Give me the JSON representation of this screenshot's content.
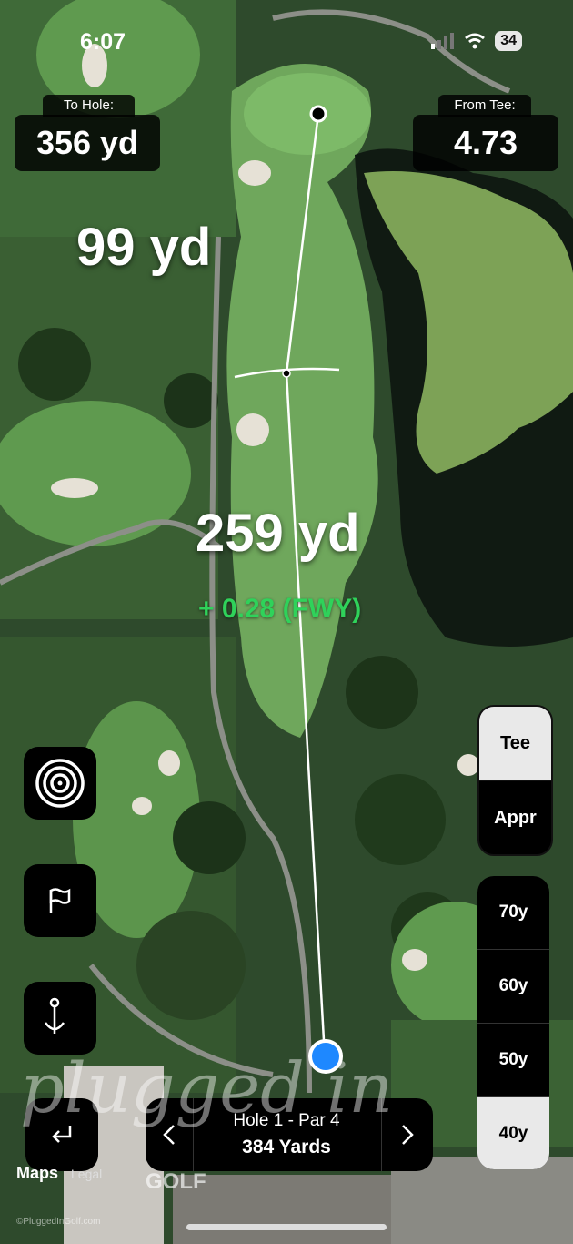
{
  "status": {
    "time": "6:07",
    "battery": "34"
  },
  "to_hole": {
    "label": "To Hole:",
    "value": "356 yd"
  },
  "from_tee": {
    "label": "From Tee:",
    "value": "4.73"
  },
  "upper_distance": "99 yd",
  "lower_distance": "259 yd",
  "strokes_gained": "+ 0.28 (FWY)",
  "side_buttons": {
    "target": "target-icon",
    "flag": "flag-icon",
    "pin": "pin-icon"
  },
  "tee_toggle": {
    "tee": "Tee",
    "approach": "Appr",
    "selected": "Tee"
  },
  "distance_options": [
    "70y",
    "60y",
    "50y",
    "40y"
  ],
  "distance_selected": "40y",
  "hole": {
    "title": "Hole 1 - Par 4",
    "yards": "384 Yards"
  },
  "map_footer": {
    "maps": "Maps",
    "legal": "Legal"
  },
  "watermark": {
    "brand": "plugged in",
    "golf": "GOLF",
    "copyright": "©PluggedInGolf.com"
  },
  "colors": {
    "accent_green": "#2fd25a",
    "shot_blue": "#1e88ff"
  }
}
